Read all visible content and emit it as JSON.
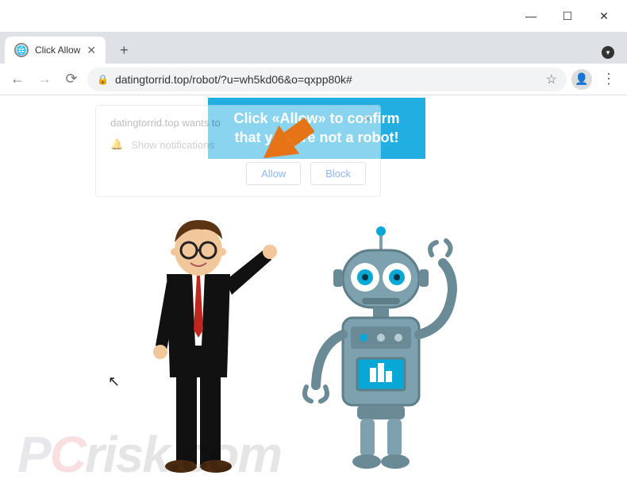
{
  "window": {
    "title": "Click Allow"
  },
  "tabs": {
    "active": {
      "title": "Click Allow"
    }
  },
  "address": {
    "url": "datingtorrid.top/robot/?u=wh5kd06&o=qxpp80k#"
  },
  "notification": {
    "site_text": "datingtorrid.top wants to",
    "permission_text": "Show notifications",
    "allow_label": "Allow",
    "block_label": "Block"
  },
  "banner": {
    "line1": "Click «Allow» to confirm",
    "line2": "that you are not a robot!"
  },
  "watermark": {
    "p": "P",
    "c": "C",
    "risk": "risk",
    "dotcom": ".com"
  },
  "icons": {
    "minimize": "—",
    "maximize": "☐",
    "close": "✕",
    "back": "←",
    "forward": "→",
    "reload": "⟳",
    "lock": "🔒",
    "star": "☆",
    "avatar": "👤",
    "menu": "⋮",
    "newtab": "+",
    "tabclose": "✕",
    "bell": "🔔",
    "notif_close": "✕",
    "cursor": "↖",
    "key": "▾"
  }
}
